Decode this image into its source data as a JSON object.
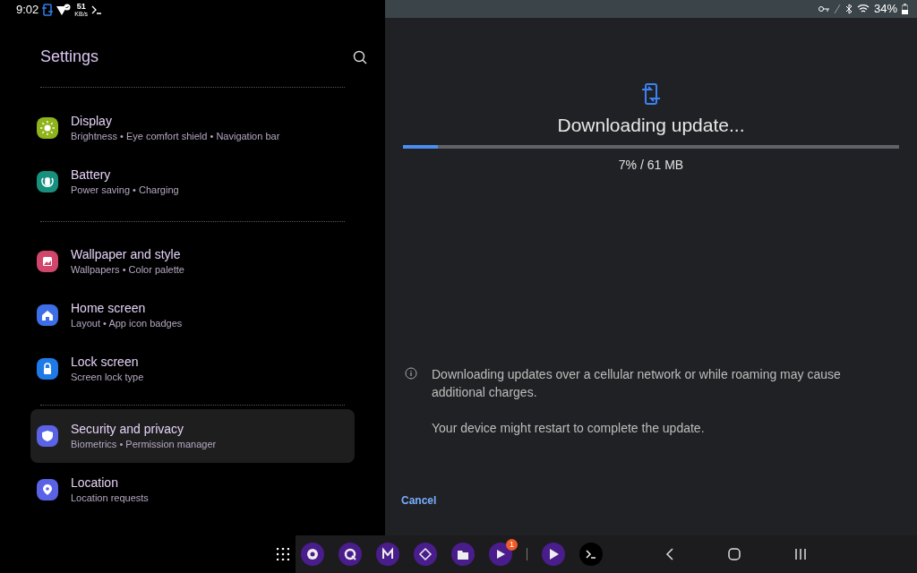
{
  "status_bar": {
    "time": "9:02",
    "speed": "51",
    "speed_unit": "KB/s",
    "battery": "34%"
  },
  "settings": {
    "title": "Settings",
    "groups": [
      [
        {
          "title": "Display",
          "subtitle": "Brightness • Eye comfort shield • Navigation bar",
          "color": "#8fb31b",
          "selected": false
        },
        {
          "title": "Battery",
          "subtitle": "Power saving • Charging",
          "color": "#17907e",
          "selected": false
        }
      ],
      [
        {
          "title": "Wallpaper and style",
          "subtitle": "Wallpapers • Color palette",
          "color": "#d1466b",
          "selected": false
        },
        {
          "title": "Home screen",
          "subtitle": "Layout • App icon badges",
          "color": "#3d6ee8",
          "selected": false
        },
        {
          "title": "Lock screen",
          "subtitle": "Screen lock type",
          "color": "#1f7ae8",
          "selected": false
        }
      ],
      [
        {
          "title": "Security and privacy",
          "subtitle": "Biometrics • Permission manager",
          "color": "#5a63e6",
          "selected": true
        },
        {
          "title": "Location",
          "subtitle": "Location requests",
          "color": "#5a63e6",
          "selected": false
        }
      ]
    ]
  },
  "update": {
    "title": "Downloading update...",
    "level": 0.07,
    "progress": "7% / 61 MB",
    "notice": "Downloading updates over a cellular network or while roaming may cause additional charges.",
    "note": "Your device might restart to complete the update.",
    "cancel": "Cancel"
  },
  "dock": {
    "badge": "1"
  }
}
